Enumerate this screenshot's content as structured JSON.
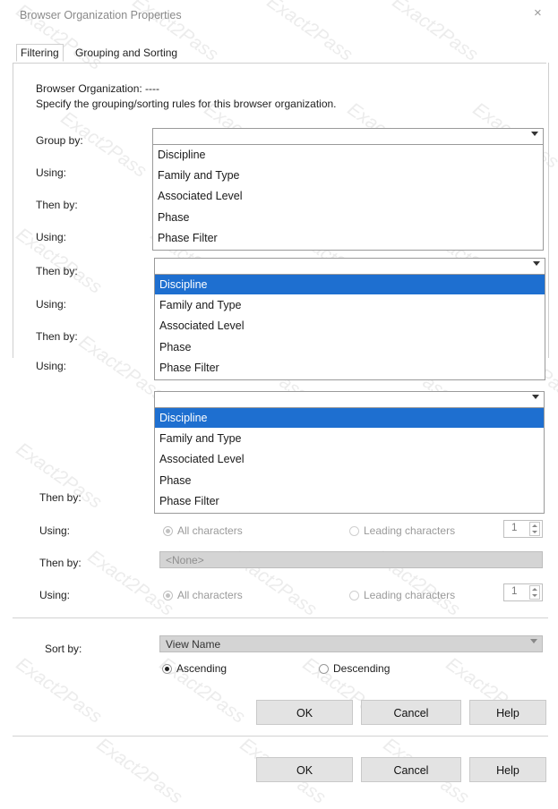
{
  "dialog": {
    "title": "Browser Organization Properties",
    "close_glyph": "×"
  },
  "tabs": [
    {
      "label": "Filtering",
      "active": true
    },
    {
      "label": "Grouping and Sorting",
      "active": false
    }
  ],
  "info": {
    "org_line": "Browser Organization: ----",
    "instruction": "Specify the grouping/sorting rules for this browser organization."
  },
  "labels": {
    "group_by": "Group by:",
    "using": "Using:",
    "then_by": "Then by:",
    "sort_by": "Sort by:"
  },
  "dropdown_options": [
    "Discipline",
    "Family and Type",
    "Associated Level",
    "Phase",
    "Phase Filter"
  ],
  "list2_selected": "Discipline",
  "list3_selected": "Discipline",
  "using_options": {
    "all": "All characters",
    "leading": "Leading characters",
    "count": "1"
  },
  "then_by_none": "<None>",
  "sort": {
    "value": "View Name",
    "ascending": "Ascending",
    "descending": "Descending",
    "selected": "Ascending"
  },
  "buttons": {
    "ok": "OK",
    "cancel": "Cancel",
    "help": "Help"
  },
  "watermark": "Exact2Pass"
}
